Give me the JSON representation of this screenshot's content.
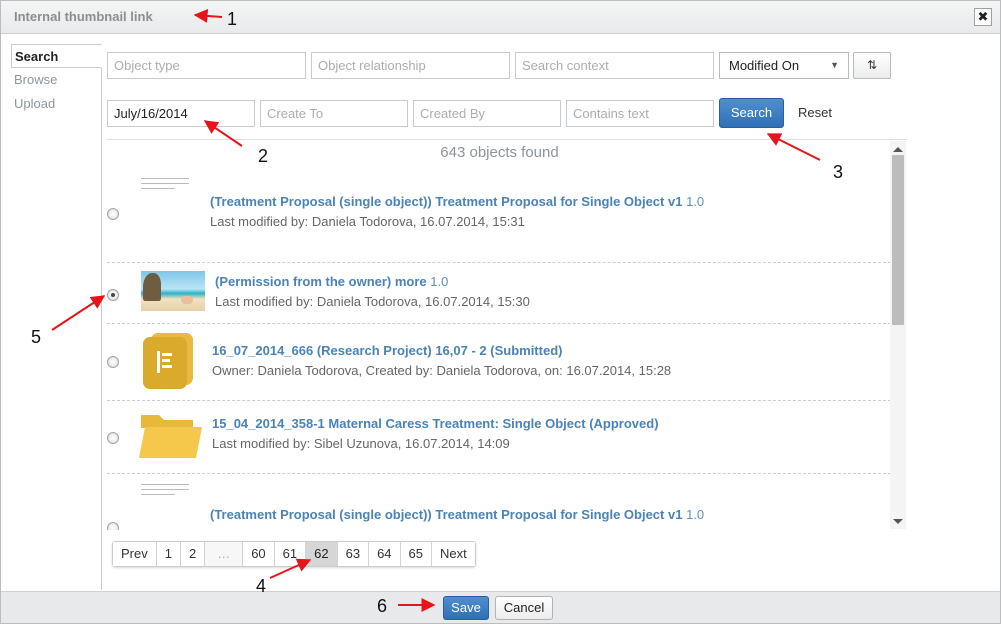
{
  "dialog": {
    "title": "Internal thumbnail link",
    "close_glyph": "✖"
  },
  "sidebar": {
    "items": [
      {
        "label": "Search"
      },
      {
        "label": "Browse"
      },
      {
        "label": "Upload"
      }
    ]
  },
  "filters": {
    "object_type_placeholder": "Object type",
    "object_relationship_placeholder": "Object relationship",
    "search_context_placeholder": "Search context",
    "sort_select_value": "Modified On",
    "date_from_value": "July/16/2014",
    "create_to_placeholder": "Create To",
    "created_by_placeholder": "Created By",
    "contains_text_placeholder": "Contains text",
    "search_label": "Search",
    "reset_label": "Reset",
    "sort_glyph": "⇅"
  },
  "results": {
    "count_text": "643 objects found",
    "items": [
      {
        "title": "(Treatment Proposal (single object)) Treatment Proposal for Single Object v1",
        "version": "1.0",
        "meta": "Last modified by: Daniela Todorova, 16.07.2014, 15:31",
        "thumbnail": "document-thumbnail",
        "selected": false
      },
      {
        "title": "(Permission from the owner) more",
        "version": "1.0",
        "meta": "Last modified by: Daniela Todorova, 16.07.2014, 15:30",
        "thumbnail": "beach-photo-thumbnail",
        "selected": true
      },
      {
        "title": "16_07_2014_666 (Research Project) 16,07 - 2 (Submitted)",
        "version": "",
        "meta": "Owner: Daniela Todorova, Created by: Daniela Todorova, on: 16.07.2014, 15:28",
        "thumbnail": "project-book-icon",
        "selected": false
      },
      {
        "title": "15_04_2014_358-1 Maternal Caress Treatment: Single Object (Approved)",
        "version": "",
        "meta": "Last modified by: Sibel Uzunova, 16.07.2014, 14:09",
        "thumbnail": "folder-icon",
        "selected": false
      },
      {
        "title": "(Treatment Proposal (single object)) Treatment Proposal for Single Object v1",
        "version": "1.0",
        "meta": "",
        "thumbnail": "document-thumbnail",
        "selected": false
      }
    ]
  },
  "pagination": {
    "pages": [
      {
        "label": "Prev",
        "active": false
      },
      {
        "label": "1",
        "active": false
      },
      {
        "label": "2",
        "active": false
      },
      {
        "label": "…",
        "active": false
      },
      {
        "label": "60",
        "active": false
      },
      {
        "label": "61",
        "active": false
      },
      {
        "label": "62",
        "active": true
      },
      {
        "label": "63",
        "active": false
      },
      {
        "label": "64",
        "active": false
      },
      {
        "label": "65",
        "active": false
      },
      {
        "label": "Next",
        "active": false
      }
    ]
  },
  "footer": {
    "save_label": "Save",
    "cancel_label": "Cancel"
  },
  "annotations": {
    "n1": "1",
    "n2": "2",
    "n3": "3",
    "n4": "4",
    "n5": "5",
    "n6": "6",
    "arrow_color": "#e8141b"
  },
  "colors": {
    "accent": "#2f6fb6",
    "link": "#4a83b8",
    "folder": "#f5c84b",
    "project": "#d9aa2c"
  }
}
